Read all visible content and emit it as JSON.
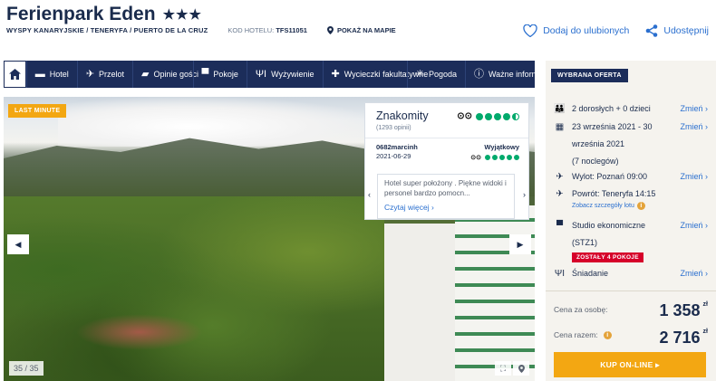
{
  "header": {
    "title": "Ferienpark Eden",
    "stars": "★★★",
    "location": "WYSPY KANARYJSKIE / TENERYFA / PUERTO DE LA CRUZ",
    "code_label": "KOD HOTELU:",
    "code_value": "TFS11051",
    "map_label": "POKAŻ NA MAPIE",
    "favorite_label": "Dodaj do ulubionych",
    "share_label": "Udostępnij"
  },
  "nav": {
    "items": [
      {
        "label": "Hotel",
        "icon": "hotel-icon"
      },
      {
        "label": "Przelot",
        "icon": "plane-icon"
      },
      {
        "label": "Opinie gości",
        "icon": "speech-bubble-icon"
      },
      {
        "label": "Pokoje",
        "icon": "bed-icon"
      },
      {
        "label": "Wyżywienie",
        "icon": "cutlery-icon"
      },
      {
        "label": "Wycieczki fakultatywne",
        "icon": "signpost-icon"
      },
      {
        "label": "Pogoda",
        "icon": "sun-icon"
      },
      {
        "label": "Ważne informacje",
        "icon": "info-icon"
      }
    ]
  },
  "gallery": {
    "badge": "LAST MINUTE",
    "counter": "35 / 35"
  },
  "review": {
    "rating_word": "Znakomity",
    "opinions": "(1293 opinii)",
    "user": "0682marcinh",
    "user_rating": "Wyjątkowy",
    "date": "2021-06-29",
    "text": "Hotel super położony . Piękne widoki i personel bardzo pomocn...",
    "more": "Czytaj więcej"
  },
  "offer": {
    "heading": "WYBRANA OFERTA",
    "change_label": "Zmień",
    "guests": "2 dorosłych + 0 dzieci",
    "dates_line1": "23 września 2021 - 30",
    "dates_line2": "września 2021",
    "dates_line3": "(7 noclegów)",
    "departure": "Wylot: Poznań 09:00",
    "return": "Powrót: Teneryfa 14:15",
    "flight_details": "Zobacz szczegóły lotu",
    "room_line1": "Studio ekonomiczne",
    "room_line2": "(STZ1)",
    "rooms_left": "ZOSTAŁY 4 POKOJE",
    "board": "Śniadanie",
    "price_person_label": "Cena za osobę:",
    "price_person": "1 358",
    "price_total_label": "Cena razem:",
    "price_total": "2 716",
    "currency": "zł",
    "cta": "KUP ON-LINE ▸"
  },
  "colors": {
    "navy": "#1c2d5a",
    "accent_orange": "#f3a712",
    "link_blue": "#2a6fcf",
    "tripadvisor_green": "#00aa6c",
    "alert_red": "#d6002a"
  }
}
